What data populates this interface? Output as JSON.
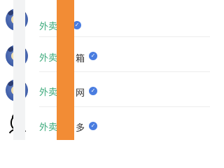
{
  "rows": [
    {
      "name": "外卖",
      "suffix": "",
      "verified": true,
      "avatar": "cartoon"
    },
    {
      "name": "外卖",
      "suffix": "箱",
      "verified": true,
      "avatar": "cartoon"
    },
    {
      "name": "外卖",
      "suffix": "网",
      "verified": true,
      "avatar": "cartoon"
    },
    {
      "name": "外卖",
      "suffix": "多",
      "verified": true,
      "avatar": "sketch"
    }
  ],
  "verified_badge_color": "#4a7de0",
  "name_color": "#3aa97a",
  "overlay_color": "#f28c35"
}
